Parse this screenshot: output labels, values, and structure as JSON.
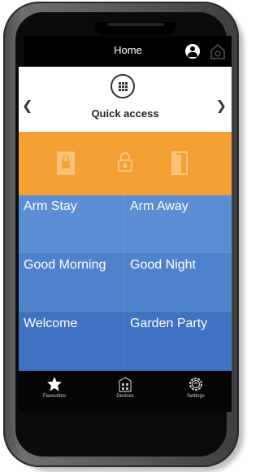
{
  "header": {
    "title": "Home"
  },
  "quick_access": {
    "label": "Quick access"
  },
  "scenes": [
    {
      "label": "Arm Stay"
    },
    {
      "label": "Arm Away"
    },
    {
      "label": "Good Morning"
    },
    {
      "label": "Good Night"
    },
    {
      "label": "Welcome"
    },
    {
      "label": "Garden Party"
    }
  ],
  "nav": {
    "items": [
      {
        "label": "Favourites",
        "icon": "star-icon"
      },
      {
        "label": "Devices",
        "icon": "devices-icon"
      },
      {
        "label": "Settings",
        "icon": "gear-icon"
      }
    ]
  },
  "colors": {
    "accent": "#f5a033",
    "tile_blue": "#4f82cc",
    "header_bg": "#000000"
  }
}
